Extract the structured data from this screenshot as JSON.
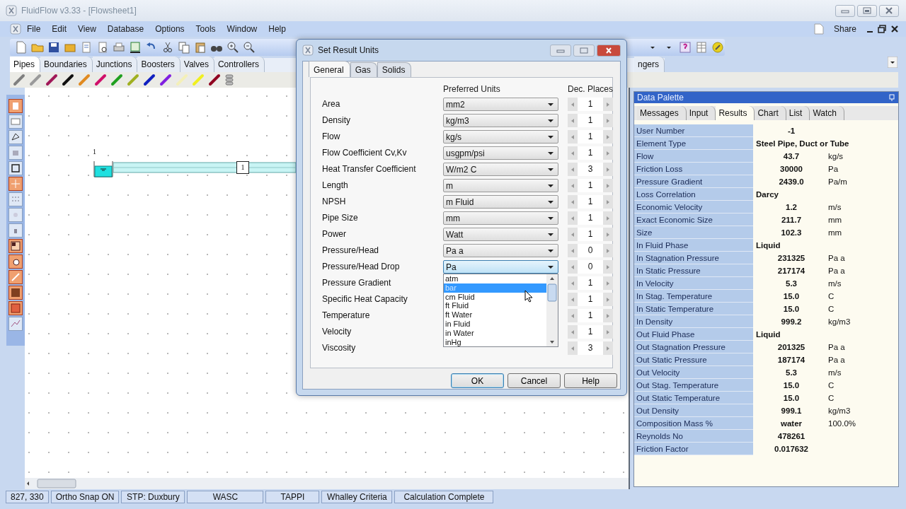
{
  "window": {
    "title": "FluidFlow v3.33 - [Flowsheet1]"
  },
  "menu": [
    "File",
    "Edit",
    "View",
    "Database",
    "Options",
    "Tools",
    "Window",
    "Help"
  ],
  "share": "Share",
  "component_tabs": [
    {
      "label": "Pipes",
      "selected": true
    },
    {
      "label": "Boundaries",
      "selected": false
    },
    {
      "label": "Junctions",
      "selected": false
    },
    {
      "label": "Boosters",
      "selected": false
    },
    {
      "label": "Valves",
      "selected": false
    },
    {
      "label": "Controllers",
      "selected": false
    },
    {
      "label": "ngers",
      "selected": false
    }
  ],
  "pipe_palette": [
    {
      "color": "#808080"
    },
    {
      "color": "#9a9a9a"
    },
    {
      "color": "#a01858"
    },
    {
      "color": "#101010"
    },
    {
      "color": "#e08a20"
    },
    {
      "color": "#d0106a"
    },
    {
      "color": "#20a020"
    },
    {
      "color": "#a0b020"
    },
    {
      "color": "#1020c0"
    },
    {
      "color": "#8020e0"
    },
    {
      "color": "#f4f0b8"
    },
    {
      "color": "#f0f020"
    },
    {
      "color": "#900020"
    }
  ],
  "canvas": {
    "node_label": "1",
    "pipe_label": "1"
  },
  "dialog": {
    "title": "Set Result Units",
    "tabs": [
      {
        "label": "General",
        "selected": true
      },
      {
        "label": "Gas",
        "selected": false
      },
      {
        "label": "Solids",
        "selected": false
      }
    ],
    "header_units": "Preferred Units",
    "header_places": "Dec. Places",
    "rows": [
      {
        "label": "Area",
        "unit": "mm2",
        "places": "1"
      },
      {
        "label": "Density",
        "unit": "kg/m3",
        "places": "1"
      },
      {
        "label": "Flow",
        "unit": "kg/s",
        "places": "1"
      },
      {
        "label": "Flow Coefficient Cv,Kv",
        "unit": "usgpm/psi",
        "places": "1"
      },
      {
        "label": "Heat Transfer Coefficient",
        "unit": "W/m2 C",
        "places": "3"
      },
      {
        "label": "Length",
        "unit": "m",
        "places": "1"
      },
      {
        "label": "NPSH",
        "unit": "m Fluid",
        "places": "1"
      },
      {
        "label": "Pipe Size",
        "unit": "mm",
        "places": "1"
      },
      {
        "label": "Power",
        "unit": "Watt",
        "places": "1"
      },
      {
        "label": "Pressure/Head",
        "unit": "Pa a",
        "places": "0"
      },
      {
        "label": "Pressure/Head Drop",
        "unit": "Pa",
        "places": "0",
        "open_list": [
          {
            "label": "atm",
            "selected": false
          },
          {
            "label": "bar",
            "selected": true
          },
          {
            "label": "cm Fluid",
            "selected": false
          },
          {
            "label": "ft Fluid",
            "selected": false
          },
          {
            "label": "ft Water",
            "selected": false
          },
          {
            "label": "in Fluid",
            "selected": false
          },
          {
            "label": "in Water",
            "selected": false
          },
          {
            "label": "inHg",
            "selected": false
          }
        ]
      },
      {
        "label": "Pressure Gradient",
        "places": "1"
      },
      {
        "label": "Specific Heat Capacity",
        "places": "1"
      },
      {
        "label": "Temperature",
        "places": "1"
      },
      {
        "label": "Velocity",
        "places": "1"
      },
      {
        "label": "Viscosity",
        "places": "3"
      }
    ],
    "buttons": [
      {
        "label": "OK",
        "default": true
      },
      {
        "label": "Cancel",
        "default": false
      },
      {
        "label": "Help",
        "default": false
      }
    ]
  },
  "data_palette": {
    "title": "Data Palette",
    "tabs": [
      {
        "label": "Messages",
        "selected": false
      },
      {
        "label": "Input",
        "selected": false
      },
      {
        "label": "Results",
        "selected": true
      },
      {
        "label": "Chart",
        "selected": false
      },
      {
        "label": "List",
        "selected": false
      },
      {
        "label": "Watch",
        "selected": false
      }
    ],
    "rows": [
      {
        "label": "User Number",
        "value": "-1",
        "kind": "number"
      },
      {
        "label": "Element Type",
        "value": "Steel Pipe, Duct or Tube",
        "kind": "text"
      },
      {
        "label": "Flow",
        "value": "43.7",
        "unit": "kg/s",
        "kind": "number"
      },
      {
        "label": "Friction Loss",
        "value": "30000",
        "unit": "Pa",
        "kind": "number"
      },
      {
        "label": "Pressure Gradient",
        "value": "2439.0",
        "unit": "Pa/m",
        "kind": "number"
      },
      {
        "label": "Loss Correlation",
        "value": "Darcy",
        "kind": "text"
      },
      {
        "label": "Economic Velocity",
        "value": "1.2",
        "unit": "m/s",
        "kind": "number"
      },
      {
        "label": "Exact Economic Size",
        "value": "211.7",
        "unit": "mm",
        "kind": "number"
      },
      {
        "label": "Size",
        "value": "102.3",
        "unit": "mm",
        "kind": "number"
      },
      {
        "label": "In Fluid Phase",
        "value": "Liquid",
        "kind": "text"
      },
      {
        "label": "In Stagnation Pressure",
        "value": "231325",
        "unit": "Pa a",
        "kind": "number"
      },
      {
        "label": "In Static Pressure",
        "value": "217174",
        "unit": "Pa a",
        "kind": "number"
      },
      {
        "label": "In Velocity",
        "value": "5.3",
        "unit": "m/s",
        "kind": "number"
      },
      {
        "label": "In Stag. Temperature",
        "value": "15.0",
        "unit": "C",
        "kind": "number"
      },
      {
        "label": "In Static Temperature",
        "value": "15.0",
        "unit": "C",
        "kind": "number"
      },
      {
        "label": "In Density",
        "value": "999.2",
        "unit": "kg/m3",
        "kind": "number"
      },
      {
        "label": "Out Fluid Phase",
        "value": "Liquid",
        "kind": "text"
      },
      {
        "label": "Out Stagnation Pressure",
        "value": "201325",
        "unit": "Pa a",
        "kind": "number"
      },
      {
        "label": "Out Static Pressure",
        "value": "187174",
        "unit": "Pa a",
        "kind": "number"
      },
      {
        "label": "Out Velocity",
        "value": "5.3",
        "unit": "m/s",
        "kind": "number"
      },
      {
        "label": "Out Stag. Temperature",
        "value": "15.0",
        "unit": "C",
        "kind": "number"
      },
      {
        "label": "Out Static Temperature",
        "value": "15.0",
        "unit": "C",
        "kind": "number"
      },
      {
        "label": "Out Density",
        "value": "999.1",
        "unit": "kg/m3",
        "kind": "number"
      },
      {
        "label": "Composition Mass %",
        "value": "water",
        "unit": "100.0%",
        "kind": "number"
      },
      {
        "label": "Reynolds No",
        "value": "478261",
        "kind": "number"
      },
      {
        "label": "Friction Factor",
        "value": "0.017632",
        "kind": "number"
      }
    ]
  },
  "status_bar": [
    "827, 330",
    "Ortho Snap ON",
    "STP: Duxbury",
    "WASC",
    "TAPPI",
    "Whalley Criteria",
    "Calculation Complete"
  ]
}
